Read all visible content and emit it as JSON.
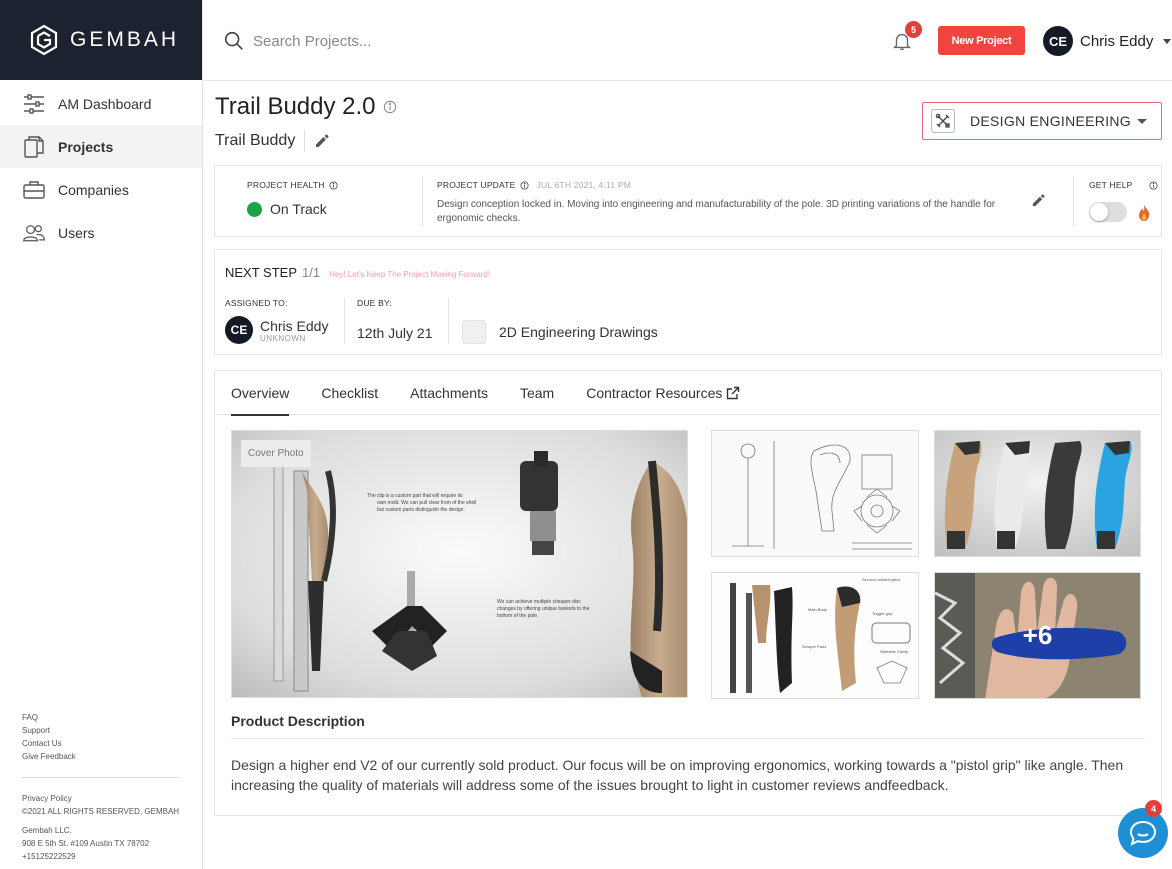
{
  "brand": {
    "name": "GEMBAH"
  },
  "sidebar": {
    "items": [
      {
        "label": "AM Dashboard",
        "icon": "sliders-icon"
      },
      {
        "label": "Projects",
        "icon": "documents-icon",
        "active": true
      },
      {
        "label": "Companies",
        "icon": "briefcase-icon"
      },
      {
        "label": "Users",
        "icon": "users-icon"
      }
    ],
    "footer_links": [
      "FAQ",
      "Support",
      "Contact Us",
      "Give Feedback"
    ],
    "privacy": "Privacy Policy",
    "copyright": "©2021 ALL RIGHTS RESERVED, GEMBAH",
    "company": "Gembah LLC.",
    "address": "908 E 5th St. #109 Austin TX 78702",
    "phone": "+15125222529"
  },
  "topbar": {
    "search_placeholder": "Search Projects...",
    "notification_count": "5",
    "new_project_label": "New Project",
    "user": {
      "initials": "CE",
      "name": "Chris Eddy"
    }
  },
  "project": {
    "title": "Trail Buddy 2.0",
    "subtitle": "Trail Buddy",
    "department": "DESIGN ENGINEERING"
  },
  "health": {
    "health_label": "PROJECT HEALTH",
    "health_status": "On Track",
    "health_color": "#19a546",
    "update_label": "PROJECT UPDATE",
    "update_date": "JUL 6TH 2021, 4:11 PM",
    "update_text": "Design conception locked in. Moving into engineering and manufacturability of the pole. 3D printing variations of the handle for ergonomic checks.",
    "help_label": "GET HELP"
  },
  "next_step": {
    "title": "NEXT STEP",
    "count": "1/1",
    "hint": "Hey! Let's Keep The Project Moving Forward!",
    "assigned_label": "ASSIGNED TO:",
    "assignee_initials": "CE",
    "assignee_name": "Chris Eddy",
    "assignee_role": "UNKNOWN",
    "due_label": "DUE BY:",
    "due_value": "12th July 21",
    "task": "2D Engineering Drawings"
  },
  "tabs": [
    "Overview",
    "Checklist",
    "Attachments",
    "Team",
    "Contractor Resources"
  ],
  "gallery": {
    "cover_label": "Cover Photo",
    "more_count": "+6"
  },
  "description": {
    "title": "Product Description",
    "text": "Design a higher end V2 of our currently sold product. Our focus will be on improving ergonomics, working towards a \"pistol grip\" like angle. Then increasing the quality of materials will address some of the issues brought to light in customer reviews andfeedback."
  },
  "chat": {
    "badge_count": "4"
  },
  "colors": {
    "brand_dark": "#1d2230",
    "accent_red": "#f0453e",
    "chat_blue": "#1e8fd5"
  }
}
